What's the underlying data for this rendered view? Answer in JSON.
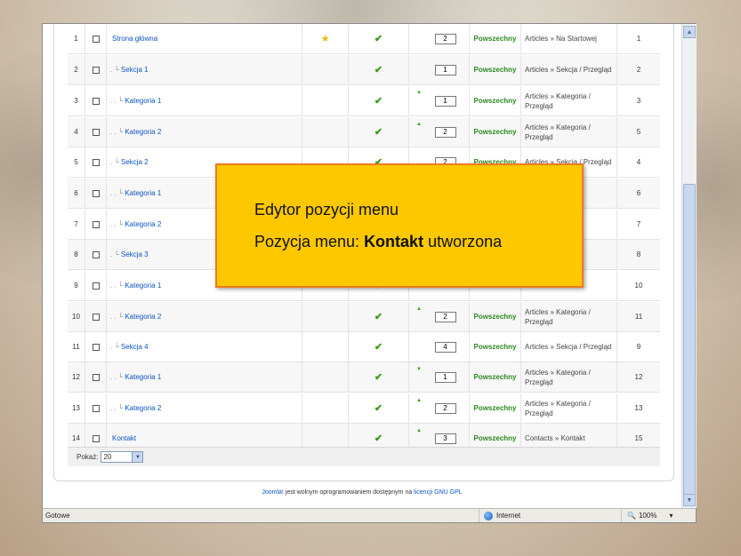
{
  "rows": [
    {
      "num": "1",
      "name": "Strona główna",
      "indent": "",
      "default": true,
      "order": "2",
      "arrow": "",
      "access": "Powszechny",
      "type": "Articles » Na Startowej",
      "id": "1"
    },
    {
      "num": "2",
      "name": "Sekcja 1",
      "indent": ". ",
      "default": false,
      "order": "1",
      "arrow": "",
      "access": "Powszechny",
      "type": "Articles » Sekcja / Przegląd",
      "id": "2"
    },
    {
      "num": "3",
      "name": "Kategoria 1",
      "indent": ". . ",
      "default": false,
      "order": "1",
      "arrow": "down",
      "access": "Powszechny",
      "type": "Articles » Kategoria / Przegląd",
      "id": "3"
    },
    {
      "num": "4",
      "name": "Kategoria 2",
      "indent": ". . ",
      "default": false,
      "order": "2",
      "arrow": "up",
      "access": "Powszechny",
      "type": "Articles » Kategoria / Przegląd",
      "id": "5"
    },
    {
      "num": "5",
      "name": "Sekcja 2",
      "indent": ". ",
      "default": false,
      "order": "2",
      "arrow": "",
      "access": "Powszechny",
      "type": "Articles » Sekcja / Przegląd",
      "id": "4"
    },
    {
      "num": "6",
      "name": "Kategoria 1",
      "indent": ". . ",
      "default": false,
      "order": "",
      "arrow": "",
      "access": "",
      "type": "a /",
      "id": "6"
    },
    {
      "num": "7",
      "name": "Kategoria 2",
      "indent": ". . ",
      "default": false,
      "order": "",
      "arrow": "",
      "access": "",
      "type": "a /",
      "id": "7"
    },
    {
      "num": "8",
      "name": "Sekcja 3",
      "indent": ". ",
      "default": false,
      "order": "",
      "arrow": "",
      "access": "",
      "type": "Przegląd",
      "id": "8"
    },
    {
      "num": "9",
      "name": "Kategoria 1",
      "indent": ". . ",
      "default": false,
      "order": "",
      "arrow": "",
      "access": "",
      "type": "a /",
      "id": "10"
    },
    {
      "num": "10",
      "name": "Kategoria 2",
      "indent": ". . ",
      "default": false,
      "order": "2",
      "arrow": "up",
      "access": "Powszechny",
      "type": "Articles » Kategoria / Przegląd",
      "id": "11"
    },
    {
      "num": "11",
      "name": "Sekcja 4",
      "indent": ". ",
      "default": false,
      "order": "4",
      "arrow": "",
      "access": "Powszechny",
      "type": "Articles » Sekcja / Przegląd",
      "id": "9"
    },
    {
      "num": "12",
      "name": "Kategoria 1",
      "indent": ". . ",
      "default": false,
      "order": "1",
      "arrow": "down",
      "access": "Powszechny",
      "type": "Articles » Kategoria / Przegląd",
      "id": "12"
    },
    {
      "num": "13",
      "name": "Kategoria 2",
      "indent": ". . ",
      "default": false,
      "order": "2",
      "arrow": "up",
      "access": "Powszechny",
      "type": "Articles » Kategoria / Przegląd",
      "id": "13"
    },
    {
      "num": "14",
      "name": "Kontakt",
      "indent": "",
      "default": false,
      "order": "3",
      "arrow": "up",
      "access": "Powszechny",
      "type": "Contacts » Kontakt",
      "id": "15"
    }
  ],
  "footer": {
    "show_label": "Pokaż:",
    "show_value": "20"
  },
  "license": {
    "pre": "",
    "joomla": "Joomla!",
    "mid": " jest wolnym oprogramowaniem dostępnym na ",
    "gpl": "licencji GNU GPL"
  },
  "statusbar": {
    "status": "Gotowe",
    "zone": "Internet",
    "zoom": "100%"
  },
  "overlay": {
    "line1": "Edytor pozycji menu",
    "line2_pre": "Pozycja menu: ",
    "line2_bold": "Kontakt",
    "line2_post": " utworzona"
  },
  "icons": {
    "published": "checkmark-icon",
    "default": "star-icon"
  },
  "colors": {
    "overlay_bg": "#fdc800",
    "overlay_border": "#f07a1a",
    "link": "#0b55c4",
    "access": "#2a8a1e"
  }
}
